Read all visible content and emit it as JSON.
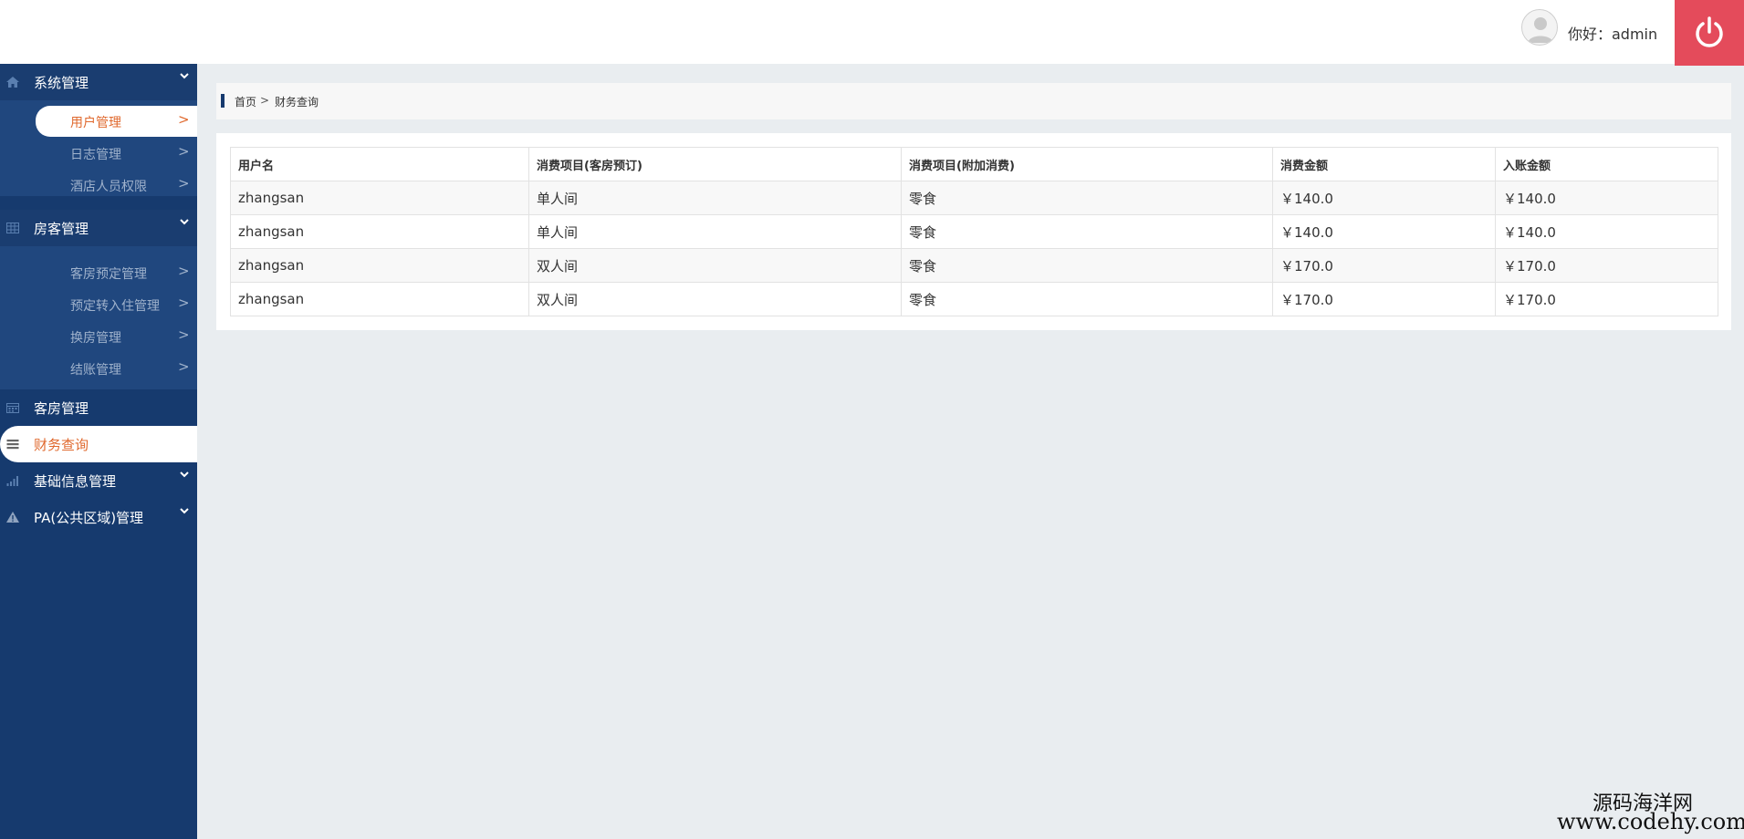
{
  "header": {
    "greeting": "你好：admin",
    "power_icon": "power-icon",
    "avatar_icon": "user-avatar-icon",
    "accent_color": "#e44b5b"
  },
  "sidebar": {
    "bg_color": "#163a6e",
    "active_color": "#e0692e",
    "groups": [
      {
        "label": "系统管理",
        "icon": "home-icon",
        "expanded": true,
        "items": [
          {
            "label": "用户管理",
            "arrow": ">",
            "active": true
          },
          {
            "label": "日志管理",
            "arrow": ">"
          },
          {
            "label": "酒店人员权限",
            "arrow": ">"
          }
        ]
      },
      {
        "label": "房客管理",
        "icon": "grid-icon",
        "expanded": true,
        "items": [
          {
            "label": "客房预定管理",
            "arrow": ">"
          },
          {
            "label": "预定转入住管理",
            "arrow": ">"
          },
          {
            "label": "换房管理",
            "arrow": ">"
          },
          {
            "label": "结账管理",
            "arrow": ">"
          }
        ]
      },
      {
        "label": "客房管理",
        "icon": "calendar-icon"
      },
      {
        "label": "财务查询",
        "icon": "list-icon",
        "active": true
      },
      {
        "label": "基础信息管理",
        "icon": "signal-icon",
        "expanded": false
      },
      {
        "label": "PA(公共区域)管理",
        "icon": "warning-icon",
        "expanded": false
      }
    ]
  },
  "breadcrumb": {
    "home": "首页",
    "separator": ">",
    "current": "财务查询"
  },
  "table": {
    "headers": [
      "用户名",
      "消费项目(客房预订)",
      "消费项目(附加消费)",
      "消费金额",
      "入账金额"
    ],
    "rows": [
      [
        "zhangsan",
        "单人间",
        "零食",
        "￥140.0",
        "￥140.0"
      ],
      [
        "zhangsan",
        "单人间",
        "零食",
        "￥140.0",
        "￥140.0"
      ],
      [
        "zhangsan",
        "双人间",
        "零食",
        "￥170.0",
        "￥170.0"
      ],
      [
        "zhangsan",
        "双人间",
        "零食",
        "￥170.0",
        "￥170.0"
      ]
    ]
  },
  "watermark": {
    "line1": "源码海洋网",
    "line2": "www.codehy.com"
  }
}
